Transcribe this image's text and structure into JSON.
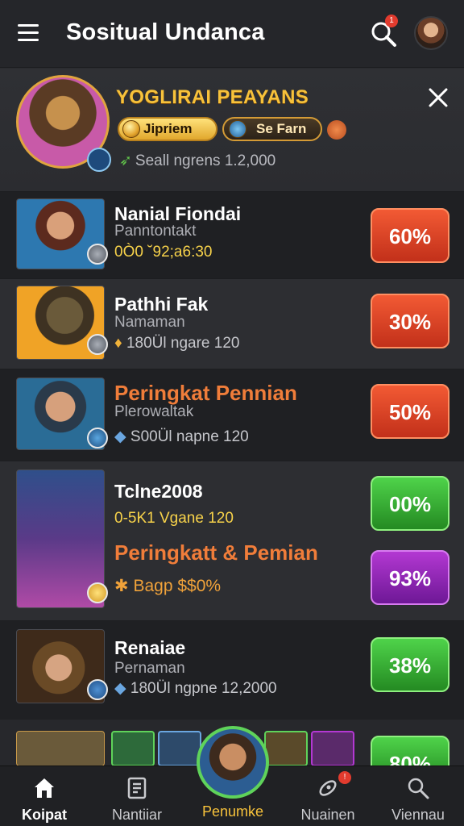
{
  "header": {
    "title": "Sositual Undanca",
    "notification_count": "1"
  },
  "banner": {
    "title": "YOGLIRAI PEAYANS",
    "pill_1": "Jipriem",
    "pill_2": "Se Farn",
    "stat": "Seall ngrens 1.2,000"
  },
  "rows": [
    {
      "name": "Nanial Fiondai",
      "sub": "Panntontakt",
      "meta": "0Ò0 ˘92;a6:30",
      "percent": "60%"
    },
    {
      "name": "Pathhi Fak",
      "sub": "Namaman",
      "meta": "180Ül ngare 120",
      "percent": "30%"
    },
    {
      "name": "Peringkat Pennian",
      "sub": "Plerowaltak",
      "meta": "S00Ül napne 120",
      "percent": "50%"
    },
    {
      "name": "Tclne2008",
      "meta": "0-5K1  Vgane 120",
      "name_2": "Peringkatt & Pemian",
      "meta_2": "Bagp $$0%",
      "percent": "00%",
      "percent_2": "93%"
    },
    {
      "name": "Renaiae",
      "sub": "Pernaman",
      "meta": "180Ül ngpne 12,2000",
      "percent": "38%"
    }
  ],
  "partial_row": {
    "percent": "80%"
  },
  "nav": {
    "items": [
      {
        "label": "Koipat"
      },
      {
        "label": "Nantiiar"
      },
      {
        "label": "Penumke"
      },
      {
        "label": "Nuainen"
      },
      {
        "label": "Viennau"
      }
    ]
  },
  "colors": {
    "accent_gold": "#f7c23b",
    "accent_orange": "#f07d3a",
    "status_red": "#e04526",
    "status_green": "#37b336",
    "status_purple": "#9428b8"
  }
}
